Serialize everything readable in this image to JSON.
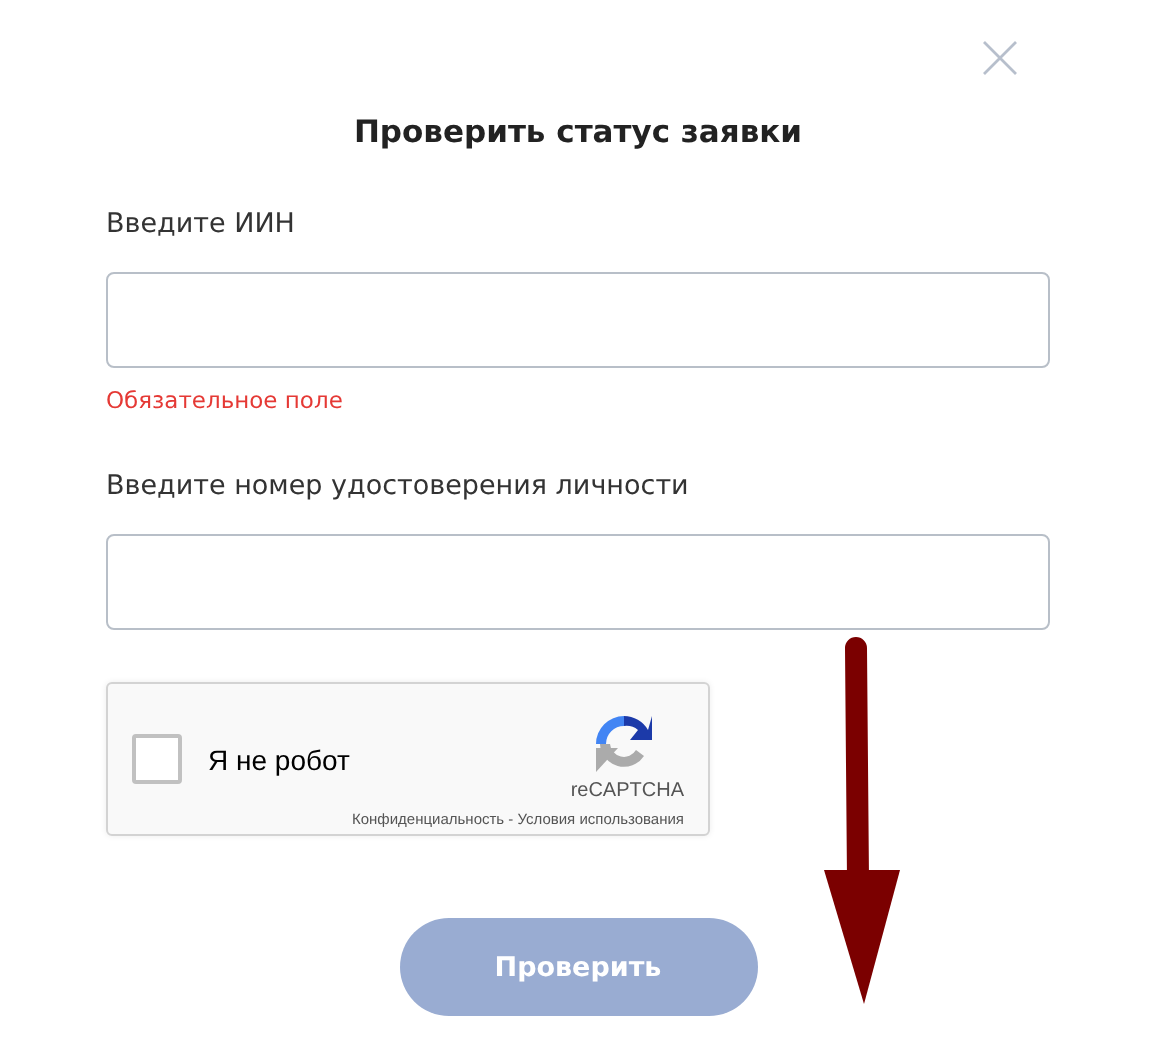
{
  "dialog": {
    "title": "Проверить статус заявки"
  },
  "fields": [
    {
      "label": "Введите ИИН",
      "error": "Обязательное поле"
    },
    {
      "label": "Введите номер удостоверения личности"
    }
  ],
  "captcha": {
    "label": "Я не робот",
    "checked": false,
    "brand": "reCAPTCHA",
    "links": "Конфиденциальность - Условия использования"
  },
  "submit": {
    "label": "Проверить",
    "disabled": true
  }
}
